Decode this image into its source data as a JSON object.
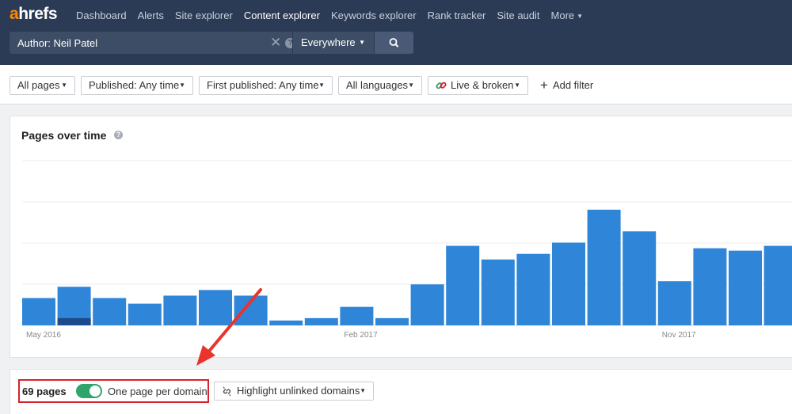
{
  "app": {
    "logo_a": "a",
    "logo_rest": "hrefs"
  },
  "nav": {
    "items": [
      {
        "label": "Dashboard",
        "active": false
      },
      {
        "label": "Alerts",
        "active": false
      },
      {
        "label": "Site explorer",
        "active": false
      },
      {
        "label": "Content explorer",
        "active": true
      },
      {
        "label": "Keywords explorer",
        "active": false
      },
      {
        "label": "Rank tracker",
        "active": false
      },
      {
        "label": "Site audit",
        "active": false
      }
    ],
    "more_label": "More"
  },
  "search": {
    "value": "Author: Neil Patel",
    "clear_icon": "close-icon",
    "help_icon": "help-icon",
    "scope_value": "Everywhere",
    "submit_icon": "search-icon"
  },
  "filters": {
    "items": [
      {
        "label": "All pages"
      },
      {
        "label": "Published: Any time"
      },
      {
        "label": "First published: Any time"
      },
      {
        "label": "All languages"
      },
      {
        "label": "Live & broken"
      }
    ],
    "add_filter_label": "Add filter"
  },
  "chart": {
    "title": "Pages over time",
    "help_icon": "help-icon"
  },
  "chart_data": {
    "type": "bar",
    "title": "Pages over time",
    "tick_labels": [
      "May 2016",
      "Feb 2017",
      "Nov 2017"
    ],
    "categories": [
      "2016-05",
      "2016-06",
      "2016-07",
      "2016-08",
      "2016-09",
      "2016-10",
      "2016-11",
      "2016-12",
      "2017-01",
      "2017-02",
      "2017-03",
      "2017-04",
      "2017-05",
      "2017-06",
      "2017-07",
      "2017-08",
      "2017-09",
      "2017-10",
      "2017-11",
      "2017-12",
      "2018-01",
      "2018-02"
    ],
    "series": [
      {
        "values": [
          34,
          48,
          34,
          27,
          37,
          44,
          37,
          6,
          9,
          23,
          9,
          51,
          99,
          82,
          89,
          103,
          144,
          117,
          55,
          96,
          93,
          99
        ],
        "color": "#2f86d9"
      },
      {
        "values": [
          0,
          9,
          0,
          0,
          0,
          0,
          0,
          0,
          0,
          0,
          0,
          0,
          0,
          0,
          0,
          0,
          0,
          0,
          0,
          0,
          0,
          0
        ],
        "color": "#1d4b8a"
      }
    ],
    "ylim": [
      0,
      205
    ],
    "grid": true
  },
  "results": {
    "count_label": "69 pages",
    "toggle_on": true,
    "toggle_label": "One page per domain",
    "highlight_label": "Highlight unlinked domains"
  },
  "colors": {
    "nav_bg": "#2b3a55",
    "bar": "#2f86d9",
    "bar_dark": "#1d4b8a",
    "toggle_on": "#2fa56b",
    "annotation_red": "#d7232c"
  }
}
